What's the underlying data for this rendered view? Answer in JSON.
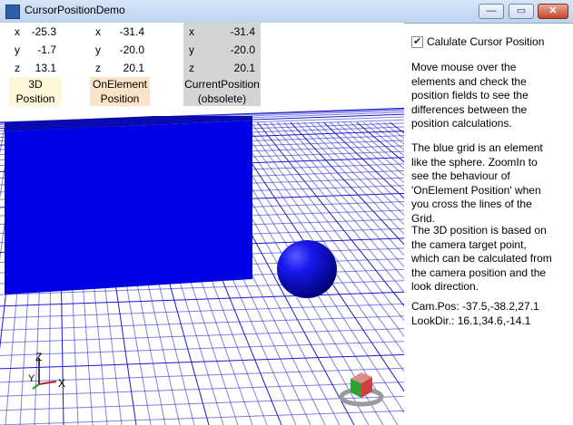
{
  "window": {
    "title": "CursorPositionDemo",
    "buttons": {
      "minimize": "—",
      "maximize": "▭",
      "close": "✕"
    }
  },
  "tables": [
    {
      "rows": [
        {
          "axis": "x",
          "value": "-25.3"
        },
        {
          "axis": "y",
          "value": "-1.7"
        },
        {
          "axis": "z",
          "value": "13.1"
        }
      ],
      "caption_line1": "3D",
      "caption_line2": "Position",
      "caption_bg": "#fff7da"
    },
    {
      "rows": [
        {
          "axis": "x",
          "value": "-31.4"
        },
        {
          "axis": "y",
          "value": "-20.0"
        },
        {
          "axis": "z",
          "value": "20.1"
        }
      ],
      "caption_line1": "OnElement",
      "caption_line2": "Position",
      "caption_bg": "#fbe4c8"
    },
    {
      "rows": [
        {
          "axis": "x",
          "value": "-31.4"
        },
        {
          "axis": "y",
          "value": "-20.0"
        },
        {
          "axis": "z",
          "value": "20.1"
        }
      ],
      "caption_line1": "CurrentPosition",
      "caption_line2": "(obsolete)",
      "caption_bg": "#fbe4c8",
      "table_bg": "#d4d4d4"
    }
  ],
  "axis_gizmo": {
    "z": "Z",
    "y": "Y",
    "x": "X"
  },
  "sidebar": {
    "checkbox_label": "Calulate Cursor Position",
    "checked": true,
    "paragraphs": [
      "Move mouse over the elements and check the position fields to see the differences between the position calculations.",
      "The blue grid is an element like the sphere. ZoomIn to see the behaviour of 'OnElement Position' when you cross the lines of the Grid.",
      "The 3D position is based on the camera target point, which can be calculated from the camera position and the look direction."
    ],
    "cam_pos": "Cam.Pos: -37.5,-38.2,27.1",
    "look_dir": "LookDir.: 16.1,34.6,-14.1"
  },
  "colors": {
    "box_front": "#0000e6",
    "box_top": "#0a0ab0",
    "grid": "#1a1ad0",
    "sphere": "#0000cc"
  }
}
